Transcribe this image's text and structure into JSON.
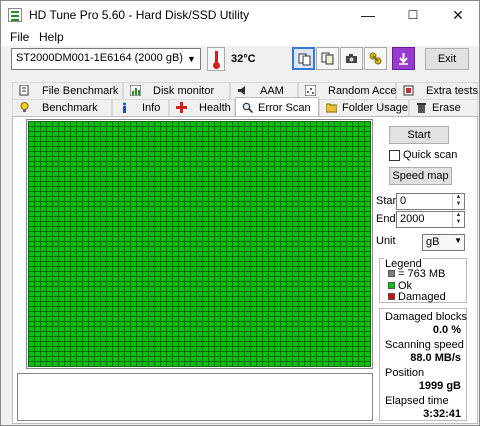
{
  "window": {
    "title": "HD Tune Pro 5.60 - Hard Disk/SSD Utility",
    "minimize": "—",
    "maximize": "☐",
    "close": "✕"
  },
  "menu": {
    "file": "File",
    "help": "Help"
  },
  "toolbar": {
    "drive": "ST2000DM001-1E6164 (2000 gB)",
    "temperature": "32°C",
    "exit": "Exit"
  },
  "tabs_row1": [
    "File Benchmark",
    "Disk monitor",
    "AAM",
    "Random Access",
    "Extra tests"
  ],
  "tabs_row2": [
    "Benchmark",
    "Info",
    "Health",
    "Error Scan",
    "Folder Usage",
    "Erase"
  ],
  "selected_tab": "Error Scan",
  "scan": {
    "start_button": "Start",
    "quick_scan_label": "Quick scan",
    "quick_scan_checked": false,
    "speed_map_button": "Speed map",
    "start_label": "Start",
    "start_value": "0",
    "end_label": "End",
    "end_value": "2000",
    "unit_label": "Unit",
    "unit_value": "gB"
  },
  "legend": {
    "title": "Legend",
    "block_size": "= 763 MB",
    "ok": "Ok",
    "damaged": "Damaged",
    "colors": {
      "block": "#808080",
      "ok": "#10c010",
      "damaged": "#d01010"
    }
  },
  "stats": {
    "damaged_blocks_label": "Damaged blocks",
    "damaged_blocks_value": "0.0 %",
    "scanning_speed_label": "Scanning speed",
    "scanning_speed_value": "88.0 MB/s",
    "position_label": "Position",
    "position_value": "1999 gB",
    "elapsed_label": "Elapsed time",
    "elapsed_value": "3:32:41"
  }
}
